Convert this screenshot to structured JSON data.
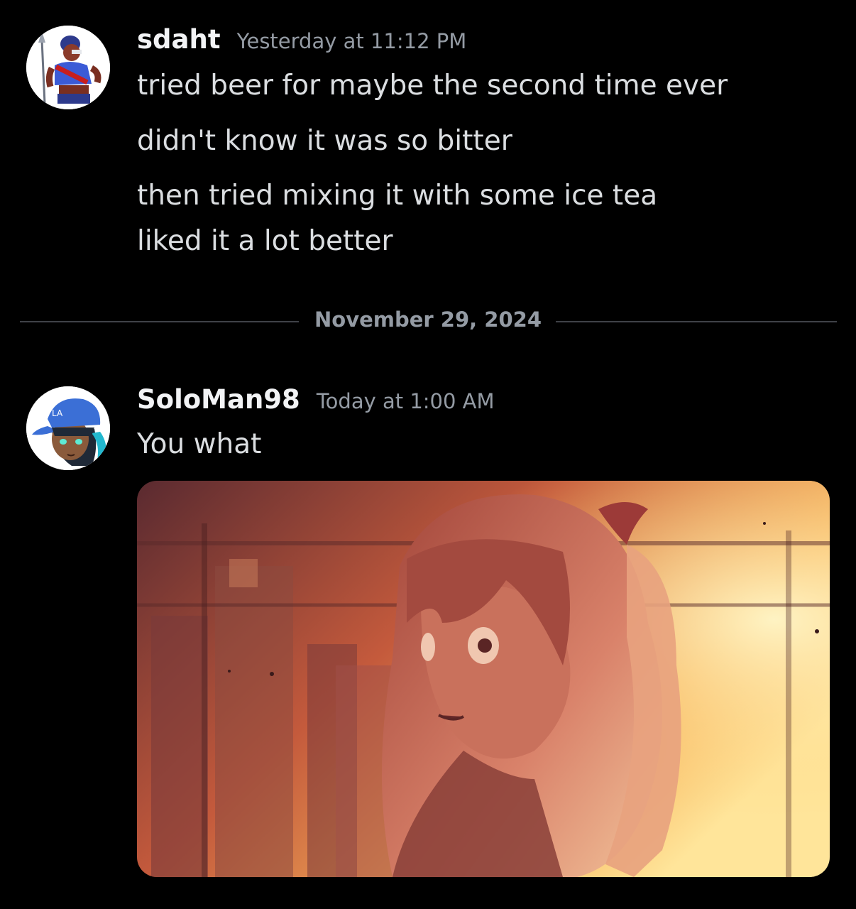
{
  "messages": [
    {
      "username": "sdaht",
      "timestamp": "Yesterday at 11:12 PM",
      "lines": [
        "tried beer for maybe the second time ever",
        "didn't know it was so bitter",
        "then tried mixing it with some ice tea",
        "liked it a lot better"
      ]
    },
    {
      "username": "SoloMan98",
      "timestamp": "Today at 1:00 AM",
      "lines": [
        "You what"
      ]
    }
  ],
  "date_divider": "November 29, 2024",
  "colors": {
    "background": "#000000",
    "username": "#f2f3f5",
    "timestamp": "#949ba4",
    "message_text": "#dbdee1",
    "divider": "#3f4147"
  }
}
